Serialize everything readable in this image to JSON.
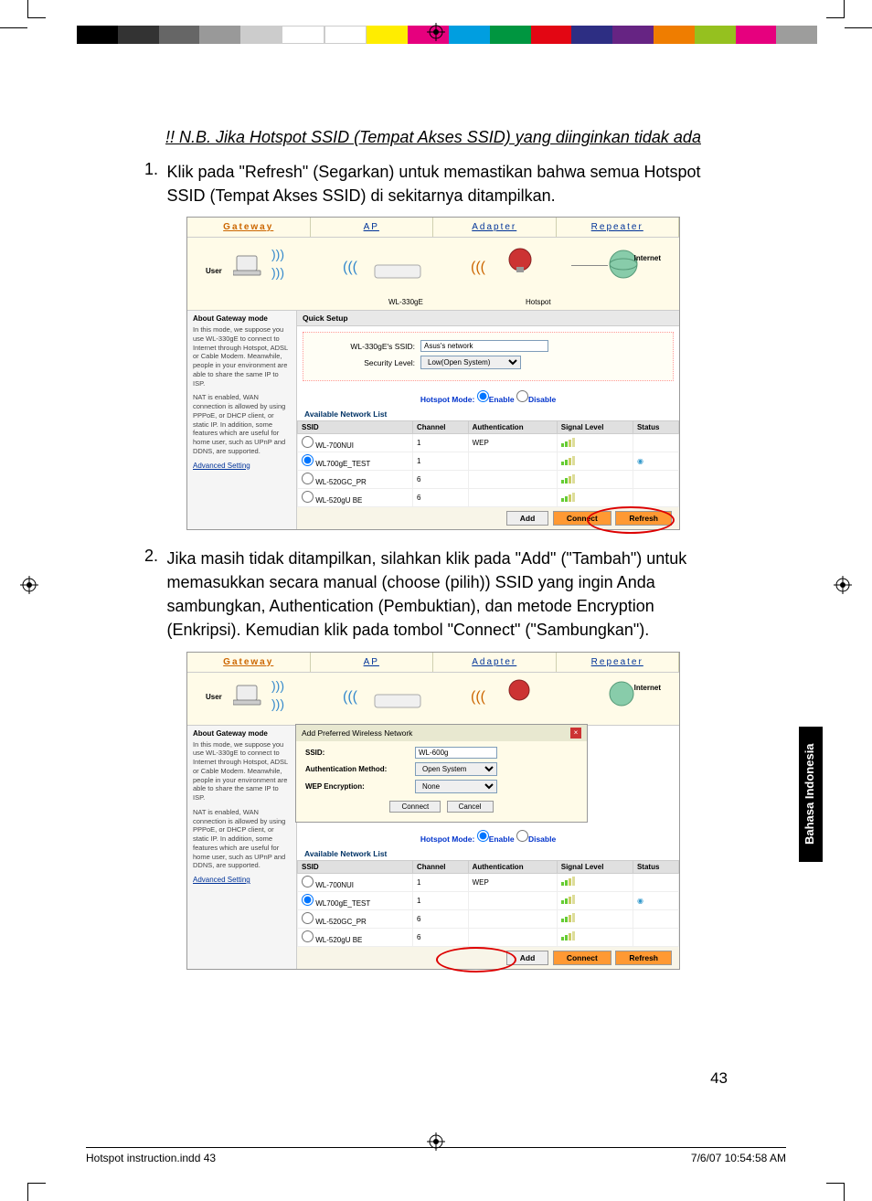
{
  "heading_nb": "!! N.B. Jika Hotspot SSID (Tempat Akses SSID) yang diinginkan tidak ada",
  "step1": {
    "num": "1.",
    "text": "Klik pada \"Refresh\" (Segarkan) untuk memastikan bahwa semua Hotspot SSID (Tempat Akses SSID) di sekitarnya ditampilkan."
  },
  "step2": {
    "num": "2.",
    "text": "Jika masih tidak ditampilkan, silahkan klik pada \"Add\" (\"Tambah\") untuk memasukkan secara manual (choose (pilih)) SSID yang ingin Anda sambungkan, Authentication (Pembuktian), dan metode Encryption (Enkripsi).  Kemudian klik pada tombol \"Connect\" (\"Sambungkan\")."
  },
  "ui": {
    "tabs": {
      "gateway": "Gateway",
      "ap": "AP",
      "adapter": "Adapter",
      "repeater": "Repeater"
    },
    "diagram": {
      "user": "User",
      "internet": "Internet",
      "device": "WL-330gE",
      "hotspot": "Hotspot"
    },
    "sidebar": {
      "title": "About Gateway mode",
      "p1": "In this mode, we suppose you use WL-330gE to connect to Internet through Hotspot, ADSL or Cable Modem. Meanwhile, people in your environment are able to share the same IP to ISP.",
      "p2": "NAT is enabled, WAN connection is allowed by using PPPoE, or DHCP client, or static IP. In addition, some features which are useful for home user, such as UPnP and DDNS, are supported.",
      "link": "Advanced Setting"
    },
    "quicksetup": "Quick Setup",
    "form": {
      "ssid_label": "WL-330gE's SSID:",
      "ssid_value": "Asus's network",
      "sec_label": "Security Level:",
      "sec_value": "Low(Open System)"
    },
    "hotspot_mode_label": "Hotspot Mode:",
    "hotspot_enable": "Enable",
    "hotspot_disable": "Disable",
    "anl_title": "Available Network List",
    "anl_headers": {
      "ssid": "SSID",
      "channel": "Channel",
      "auth": "Authentication",
      "signal": "Signal Level",
      "status": "Status"
    },
    "anl_rows": [
      {
        "ssid": "WL-700NUI",
        "ch": "1",
        "auth": "WEP"
      },
      {
        "ssid": "WL700gE_TEST",
        "ch": "1",
        "auth": ""
      },
      {
        "ssid": "WL-520GC_PR",
        "ch": "6",
        "auth": ""
      },
      {
        "ssid": "WL-520gU BE",
        "ch": "6",
        "auth": ""
      }
    ],
    "buttons": {
      "add": "Add",
      "connect": "Connect",
      "refresh": "Refresh"
    },
    "dialog": {
      "title": "Add Preferred Wireless Network",
      "ssid_label": "SSID:",
      "ssid_value": "WL-600g",
      "auth_label": "Authentication Method:",
      "auth_value": "Open System",
      "wep_label": "WEP Encryption:",
      "wep_value": "None",
      "connect": "Connect",
      "cancel": "Cancel"
    }
  },
  "lang_tab": "Bahasa Indonesia",
  "page_number": "43",
  "footer_left": "Hotspot instruction.indd   43",
  "footer_right": "7/6/07   10:54:58 AM"
}
